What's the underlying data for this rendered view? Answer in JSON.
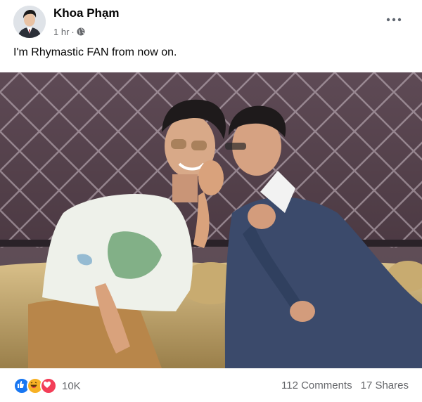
{
  "author": {
    "name": "Khoa Phạm",
    "timestamp": "1 hr"
  },
  "post": {
    "text": "I'm Rhymastic FAN from now on."
  },
  "icons": {
    "privacy": "globe-icon",
    "more": "more-options-icon",
    "reactions": [
      "like-icon",
      "haha-icon",
      "love-icon"
    ]
  },
  "footer": {
    "reaction_count": "10K",
    "comments": "112 Comments",
    "shares": "17 Shares"
  },
  "colors": {
    "like_blue": "#1877f2",
    "haha_yellow": "#f7b125",
    "love_red": "#f33e58",
    "secondary_text": "#65676b"
  }
}
